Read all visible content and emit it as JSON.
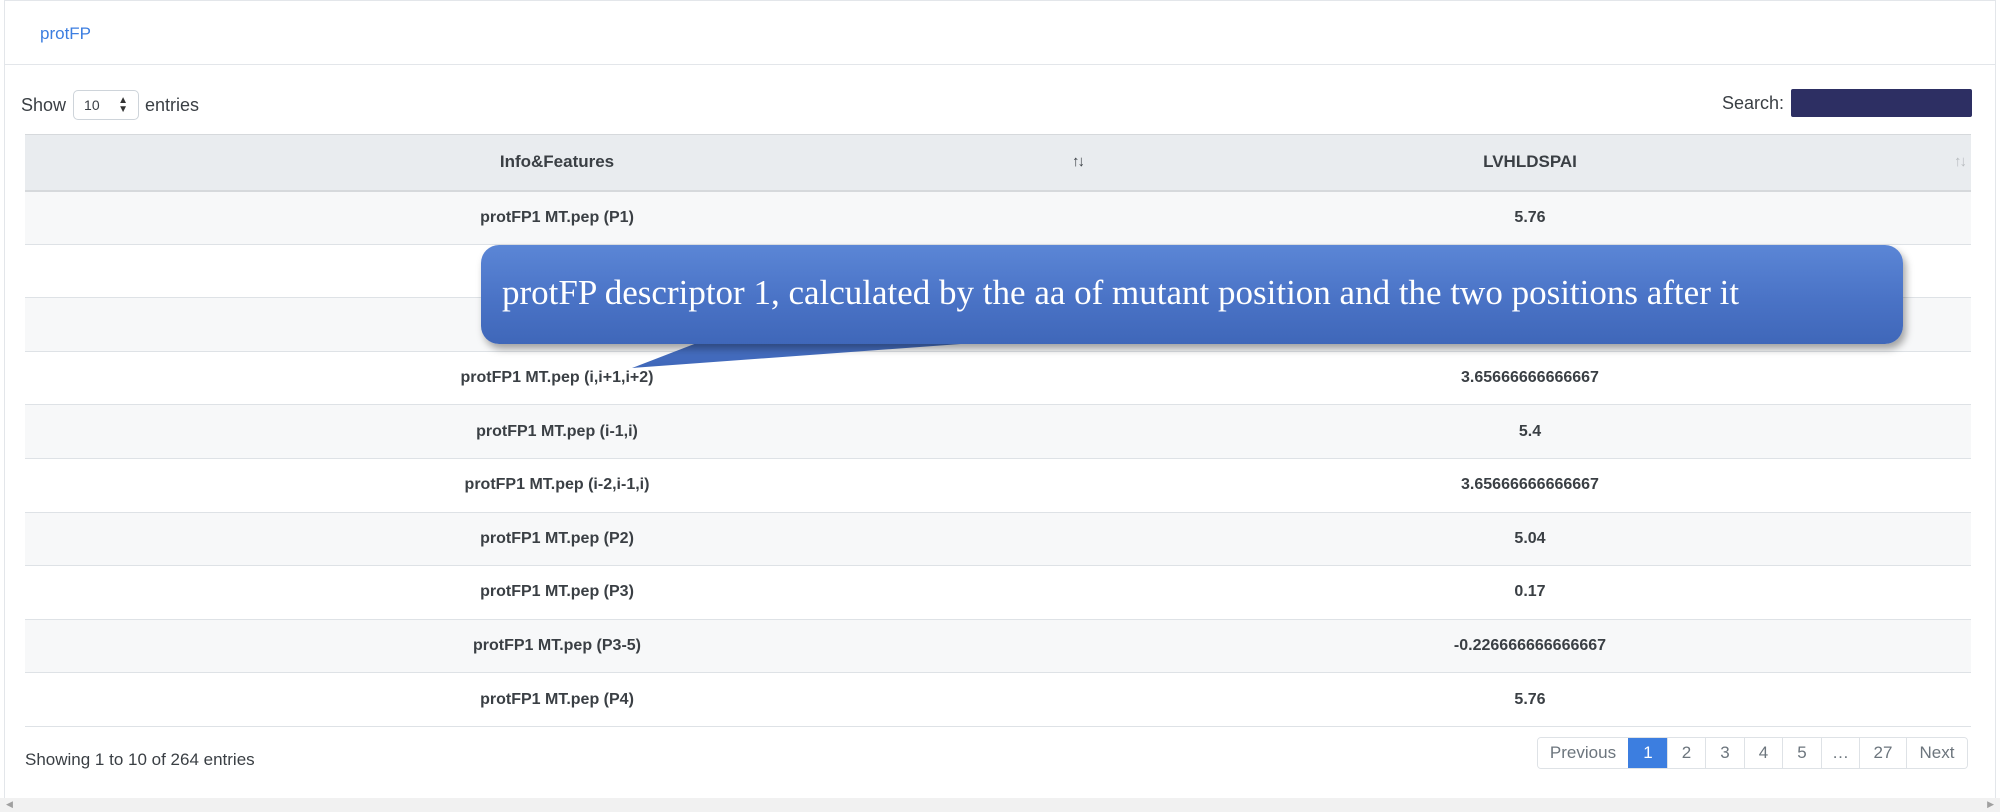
{
  "header": {
    "tab_label": "protFP"
  },
  "length_control": {
    "show_label": "Show",
    "selected_value": "10",
    "entries_label": "entries"
  },
  "search": {
    "label": "Search:",
    "value": ""
  },
  "table": {
    "columns": [
      {
        "label": "Info&Features",
        "sort_icon": "↑↓"
      },
      {
        "label": "LVHLDSPAI",
        "sort_icon": "↑↓"
      }
    ],
    "rows": [
      [
        "protFP1 MT.pep (P1)",
        "5.76"
      ],
      [
        "",
        ""
      ],
      [
        "",
        ""
      ],
      [
        "protFP1 MT.pep (i,i+1,i+2)",
        "3.65666666666667"
      ],
      [
        "protFP1 MT.pep (i-1,i)",
        "5.4"
      ],
      [
        "protFP1 MT.pep (i-2,i-1,i)",
        "3.65666666666667"
      ],
      [
        "protFP1 MT.pep (P2)",
        "5.04"
      ],
      [
        "protFP1 MT.pep (P3)",
        "0.17"
      ],
      [
        "protFP1 MT.pep (P3-5)",
        "-0.226666666666667"
      ],
      [
        "protFP1 MT.pep (P4)",
        "5.76"
      ]
    ]
  },
  "info_text": "Showing 1 to 10 of 264 entries",
  "pagination": {
    "previous": "Previous",
    "pages": [
      "1",
      "2",
      "3",
      "4",
      "5",
      "…",
      "27"
    ],
    "active_page": "1",
    "next": "Next"
  },
  "tooltip": {
    "text": "protFP descriptor 1, calculated by the aa of mutant position and the two positions after it"
  },
  "colors": {
    "accent": "#3c7ee0",
    "tooltip_bg": "#4a73c6",
    "search_bg": "#2d2f63"
  }
}
